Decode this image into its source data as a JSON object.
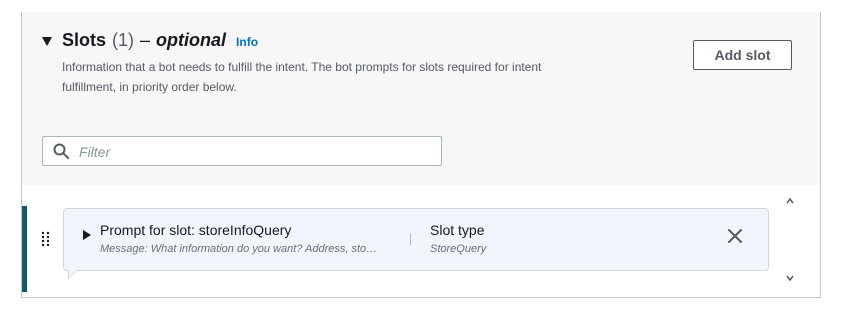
{
  "header": {
    "title": "Slots",
    "count": "(1)",
    "dash": "–",
    "optional": "optional",
    "info": "Info",
    "description": "Information that a bot needs to fulfill the intent. The bot prompts for slots required for intent fulfillment, in priority order below.",
    "add_button": "Add slot"
  },
  "filter": {
    "placeholder": "Filter",
    "value": ""
  },
  "slots": [
    {
      "title": "Prompt for slot: storeInfoQuery",
      "message": "Message: What information do you want? Address, sto…",
      "type_label": "Slot type",
      "type_value": "StoreQuery"
    }
  ],
  "colors": {
    "accent": "#0b5a70",
    "link": "#0073bb",
    "card_bg": "#f0f6fb"
  },
  "icons": [
    "caret-down-icon",
    "search-icon",
    "drag-handle-icon",
    "expand-icon",
    "close-icon",
    "scroll-up-icon",
    "scroll-down-icon"
  ]
}
